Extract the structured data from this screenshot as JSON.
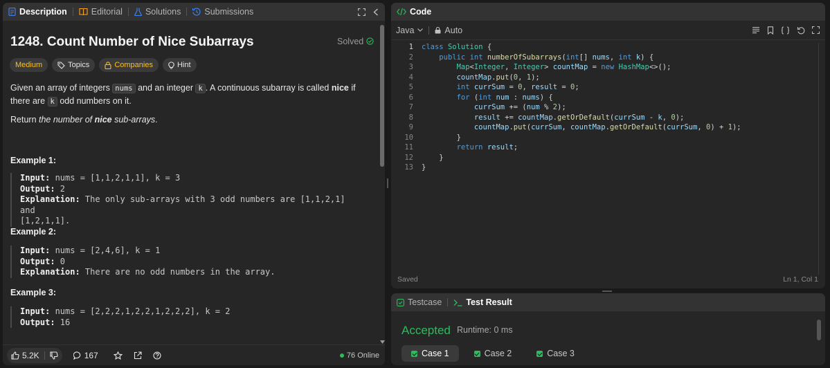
{
  "left_tabs": [
    {
      "label": "Description",
      "icon": "description-icon"
    },
    {
      "label": "Editorial",
      "icon": "book-icon"
    },
    {
      "label": "Solutions",
      "icon": "flask-icon"
    },
    {
      "label": "Submissions",
      "icon": "history-icon"
    }
  ],
  "problem": {
    "title": "1248. Count Number of Nice Subarrays",
    "solved_label": "Solved",
    "tags": {
      "difficulty": "Medium",
      "topics": "Topics",
      "companies": "Companies",
      "hint": "Hint"
    },
    "para1_a": "Given an array of integers ",
    "para1_code1": "nums",
    "para1_b": " and an integer ",
    "para1_code2": "k",
    "para1_c": ". A continuous subarray is called ",
    "para1_bold": "nice",
    "para1_d": " if there are ",
    "para1_code3": "k",
    "para1_e": " odd numbers on it.",
    "para2_a": "Return ",
    "para2_i1": "the number of ",
    "para2_bold": "nice",
    "para2_i2": " sub-arrays",
    "para2_end": ".",
    "examples": [
      {
        "title": "Example 1:",
        "input_label": "Input:",
        "input": " nums = [1,1,2,1,1], k = 3",
        "output_label": "Output:",
        "output": " 2",
        "explanation_label": "Explanation:",
        "explanation_line1": " The only sub-arrays with 3 odd numbers are [1,1,2,1] and",
        "explanation_line2": "[1,2,1,1]."
      },
      {
        "title": "Example 2:",
        "input_label": "Input:",
        "input": " nums = [2,4,6], k = 1",
        "output_label": "Output:",
        "output": " 0",
        "explanation_label": "Explanation:",
        "explanation_line1": " There are no odd numbers in the array."
      },
      {
        "title": "Example 3:",
        "input_label": "Input:",
        "input": " nums = [2,2,2,1,2,2,1,2,2,2], k = 2",
        "output_label": "Output:",
        "output": " 16"
      }
    ]
  },
  "footer": {
    "likes": "5.2K",
    "comments": "167",
    "online": "76 Online"
  },
  "code_panel": {
    "title": "Code",
    "language": "Java",
    "mode": "Auto",
    "status_left": "Saved",
    "status_right": "Ln 1, Col 1",
    "line_numbers": [
      "1",
      "2",
      "3",
      "4",
      "5",
      "6",
      "7",
      "8",
      "9",
      "10",
      "11",
      "12",
      "13"
    ]
  },
  "result_panel": {
    "tab_testcase": "Testcase",
    "tab_result": "Test Result",
    "status": "Accepted",
    "runtime": "Runtime: 0 ms",
    "cases": [
      "Case 1",
      "Case 2",
      "Case 3"
    ]
  },
  "colors": {
    "accepted": "#2cbb5d",
    "medium": "#ffc01e",
    "panel_bg": "#262626",
    "page_bg": "#1a1a1a"
  }
}
